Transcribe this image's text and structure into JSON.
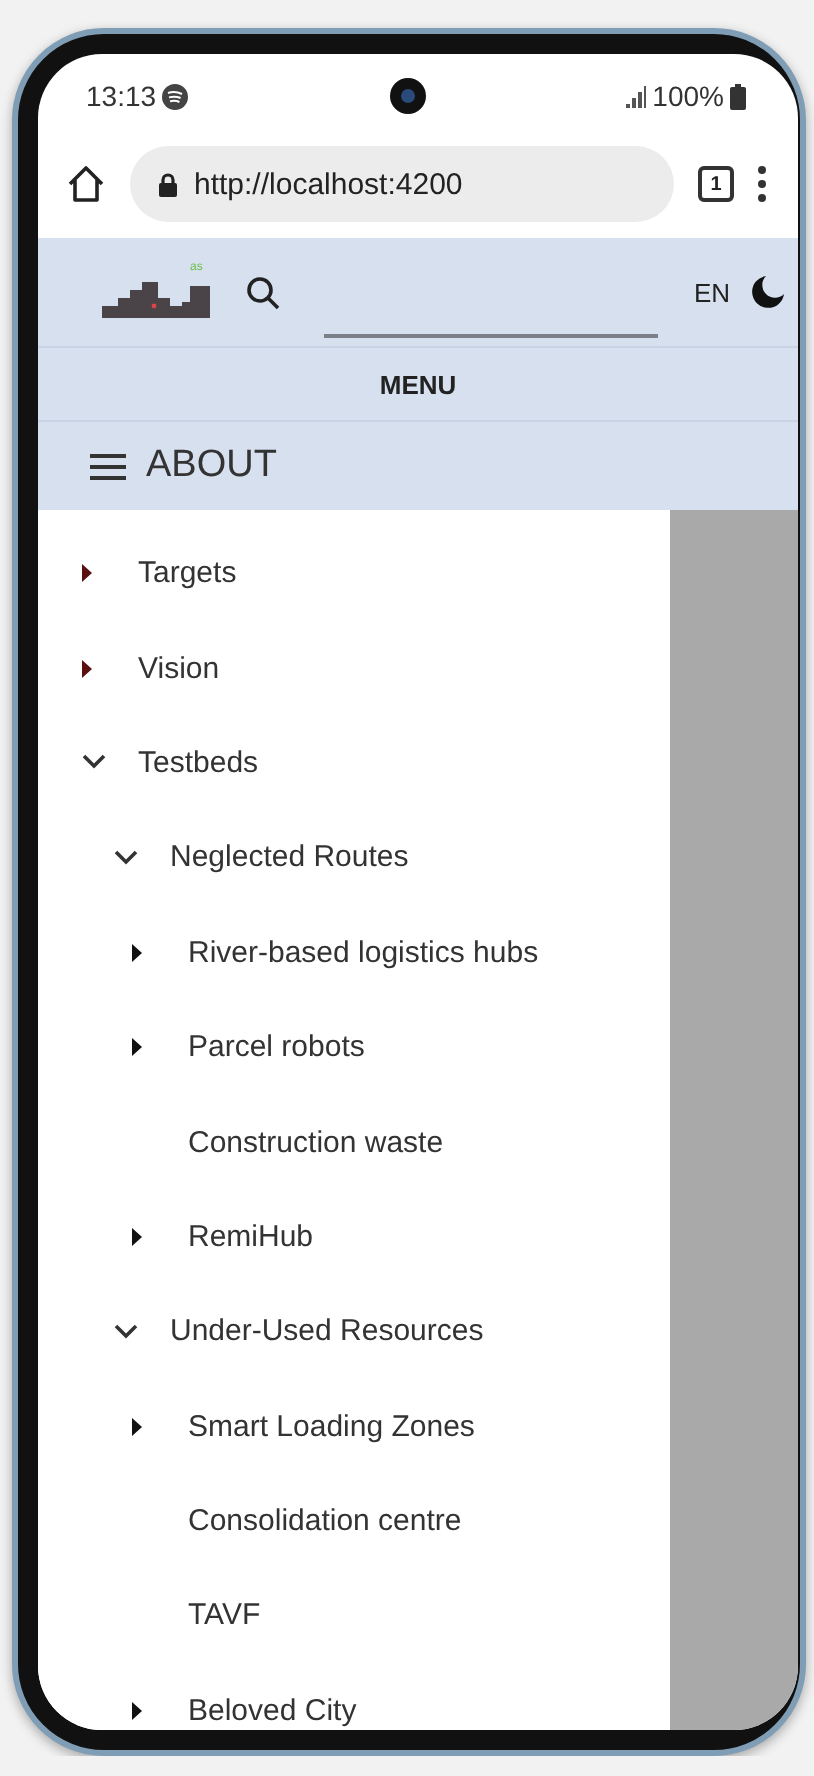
{
  "status_bar": {
    "time": "13:13",
    "battery": "100%"
  },
  "browser": {
    "url": "http://localhost:4200",
    "tab_count": "1"
  },
  "header": {
    "logo_text": "as",
    "language": "EN"
  },
  "menu": {
    "label": "MENU"
  },
  "section": {
    "title": "ABOUT"
  },
  "tree": [
    {
      "label": "Targets",
      "expanded": false
    },
    {
      "label": "Vision",
      "expanded": false
    },
    {
      "label": "Testbeds",
      "expanded": true,
      "children": [
        {
          "label": "Neglected Routes",
          "expanded": true,
          "children": [
            {
              "label": "River-based logistics hubs",
              "expanded": false
            },
            {
              "label": "Parcel robots",
              "expanded": false
            },
            {
              "label": "Construction waste"
            },
            {
              "label": "RemiHub",
              "expanded": false
            }
          ]
        },
        {
          "label": "Under-Used Resources",
          "expanded": true,
          "children": [
            {
              "label": "Smart Loading Zones",
              "expanded": false
            },
            {
              "label": "Consolidation centre"
            },
            {
              "label": "TAVF"
            },
            {
              "label": "Beloved City",
              "expanded": false
            }
          ]
        }
      ]
    }
  ]
}
